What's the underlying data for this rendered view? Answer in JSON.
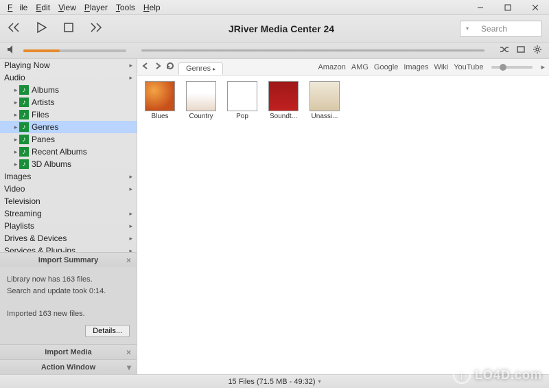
{
  "menu": {
    "file": "File",
    "edit": "Edit",
    "view": "View",
    "player": "Player",
    "tools": "Tools",
    "help": "Help"
  },
  "app_title": "JRiver Media Center 24",
  "search_placeholder": "Search",
  "sidebar": {
    "playing_now": "Playing Now",
    "audio": "Audio",
    "audio_items": [
      "Albums",
      "Artists",
      "Files",
      "Genres",
      "Panes",
      "Recent Albums",
      "3D Albums"
    ],
    "selected_index": 3,
    "images": "Images",
    "video": "Video",
    "television": "Television",
    "streaming": "Streaming",
    "playlists": "Playlists",
    "drives": "Drives & Devices",
    "services": "Services & Plug-ins"
  },
  "import_summary": {
    "title": "Import Summary",
    "line1": "Library now has 163 files.",
    "line2": "Search and update took 0:14.",
    "line3": "Imported 163 new files.",
    "details": "Details..."
  },
  "import_media": "Import Media",
  "action_window": "Action Window",
  "breadcrumb_tab": "Genres",
  "quick_links": [
    "Amazon",
    "AMG",
    "Google",
    "Images",
    "Wiki",
    "YouTube"
  ],
  "genres": [
    {
      "label": "Blues",
      "art": "blues"
    },
    {
      "label": "Country",
      "art": "country"
    },
    {
      "label": "Pop",
      "art": "pop"
    },
    {
      "label": "Soundt...",
      "art": "soundtrack"
    },
    {
      "label": "Unassi...",
      "art": "unassi"
    }
  ],
  "status": "15 Files (71.5 MB - 49:32)",
  "watermark": "LO4D.com"
}
